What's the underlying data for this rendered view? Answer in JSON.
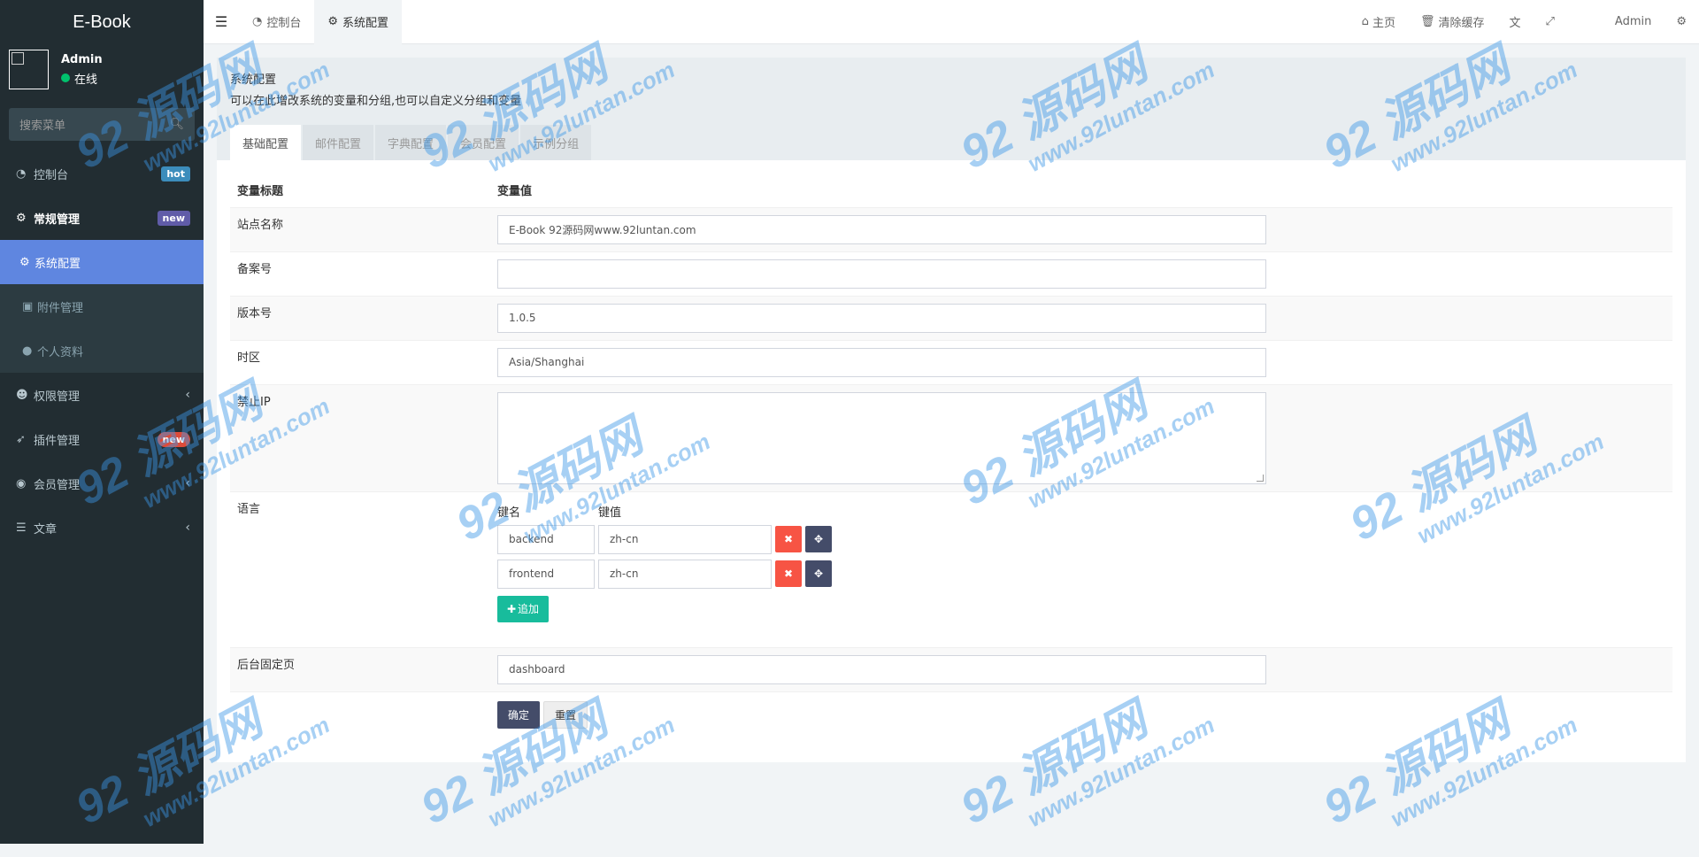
{
  "app": {
    "logo": "E-Book"
  },
  "user": {
    "name": "Admin",
    "status": "在线"
  },
  "sidebar": {
    "search_placeholder": "搜索菜单",
    "items": [
      {
        "label": "控制台",
        "icon": "dashboard-icon",
        "badge": "hot"
      },
      {
        "label": "常规管理",
        "icon": "cogs-icon",
        "badge": "new"
      },
      {
        "label": "权限管理",
        "icon": "users-icon"
      },
      {
        "label": "插件管理",
        "icon": "rocket-icon",
        "badge": "new"
      },
      {
        "label": "会员管理",
        "icon": "user-circle-icon"
      },
      {
        "label": "文章",
        "icon": "list-icon"
      }
    ],
    "subitems": [
      {
        "label": "系统配置",
        "icon": "gear-icon"
      },
      {
        "label": "附件管理",
        "icon": "image-icon"
      },
      {
        "label": "个人资料",
        "icon": "user-icon"
      }
    ]
  },
  "header": {
    "tabs": [
      {
        "label": "控制台",
        "icon": "dashboard-icon"
      },
      {
        "label": "系统配置",
        "icon": "gear-icon"
      }
    ],
    "links": {
      "home": "主页",
      "clear_cache": "清除缓存",
      "admin": "Admin"
    }
  },
  "panel": {
    "title": "系统配置",
    "description": "可以在此增改系统的变量和分组,也可以自定义分组和变量",
    "tabs": [
      "基础配置",
      "邮件配置",
      "字典配置",
      "会员配置",
      "示例分组"
    ]
  },
  "config": {
    "col_title": "变量标题",
    "col_value": "变量值",
    "rows": {
      "site_name": {
        "label": "站点名称",
        "value": "E-Book 92源码网www.92luntan.com"
      },
      "beian": {
        "label": "备案号",
        "value": ""
      },
      "version": {
        "label": "版本号",
        "value": "1.0.5"
      },
      "timezone": {
        "label": "时区",
        "value": "Asia/Shanghai"
      },
      "forbidden_ip": {
        "label": "禁止IP",
        "value": ""
      },
      "language": {
        "label": "语言",
        "key_header": "键名",
        "value_header": "键值",
        "pairs": [
          {
            "key": "backend",
            "value": "zh-cn"
          },
          {
            "key": "frontend",
            "value": "zh-cn"
          }
        ],
        "add_label": "追加"
      },
      "fixed_page": {
        "label": "后台固定页",
        "value": "dashboard"
      }
    },
    "submit_label": "确定",
    "reset_label": "重置"
  },
  "watermark": {
    "big": "92 源码网",
    "small": "www.92luntan.com"
  }
}
